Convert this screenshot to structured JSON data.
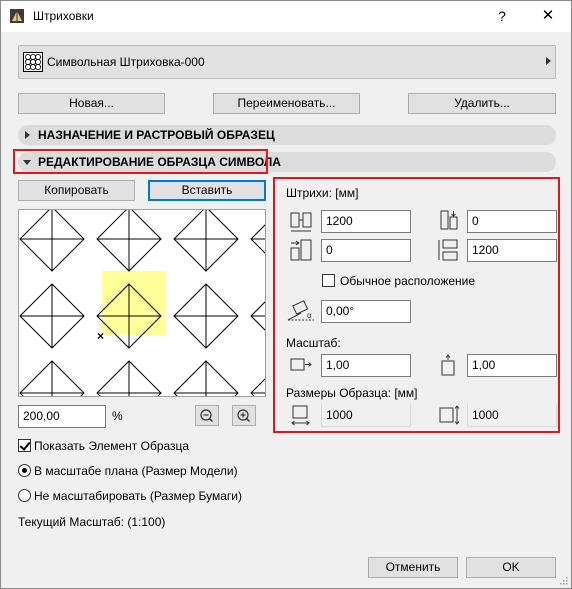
{
  "window": {
    "title": "Штриховки",
    "help_glyph": "?",
    "close_glyph": "✕"
  },
  "selector": {
    "name": "Символьная Штриховка-000",
    "icon": "pattern-grid-icon"
  },
  "top_buttons": {
    "new": "Новая...",
    "rename": "Переименовать...",
    "delete": "Удалить..."
  },
  "sections": {
    "assignment": "НАЗНАЧЕНИЕ И РАСТРОВЫЙ ОБРАЗЕЦ",
    "editing": "РЕДАКТИРОВАНИЕ ОБРАЗЦА СИМВОЛА"
  },
  "edit_buttons": {
    "copy": "Копировать",
    "paste": "Вставить"
  },
  "zoom": {
    "value": "200,00",
    "unit": "%"
  },
  "hatch": {
    "header": "Штрихи: [мм]",
    "h_spacing": "1200",
    "v_offset": "0",
    "h_offset": "0",
    "v_spacing": "1200",
    "normal_layout_label": "Обычное расположение",
    "normal_layout_checked": false,
    "angle": "0,00°"
  },
  "scale": {
    "header": "Масштаб:",
    "x": "1,00",
    "y": "1,00"
  },
  "sample_size": {
    "header": "Размеры Образца: [мм]",
    "width": "1000",
    "height": "1000"
  },
  "options": {
    "show_element": "Показать Элемент Образца",
    "show_element_checked": true,
    "model_scale": "В масштабе плана (Размер Модели)",
    "paper_scale": "Не масштабировать (Размер Бумаги)",
    "selected": "model_scale"
  },
  "current_scale": "Текущий Масштаб: (1:100)",
  "footer": {
    "cancel": "Отменить",
    "ok": "OK"
  },
  "colors": {
    "highlight": "#ffff99",
    "accent_red": "#e8141c",
    "focus_blue": "#0078d7"
  }
}
